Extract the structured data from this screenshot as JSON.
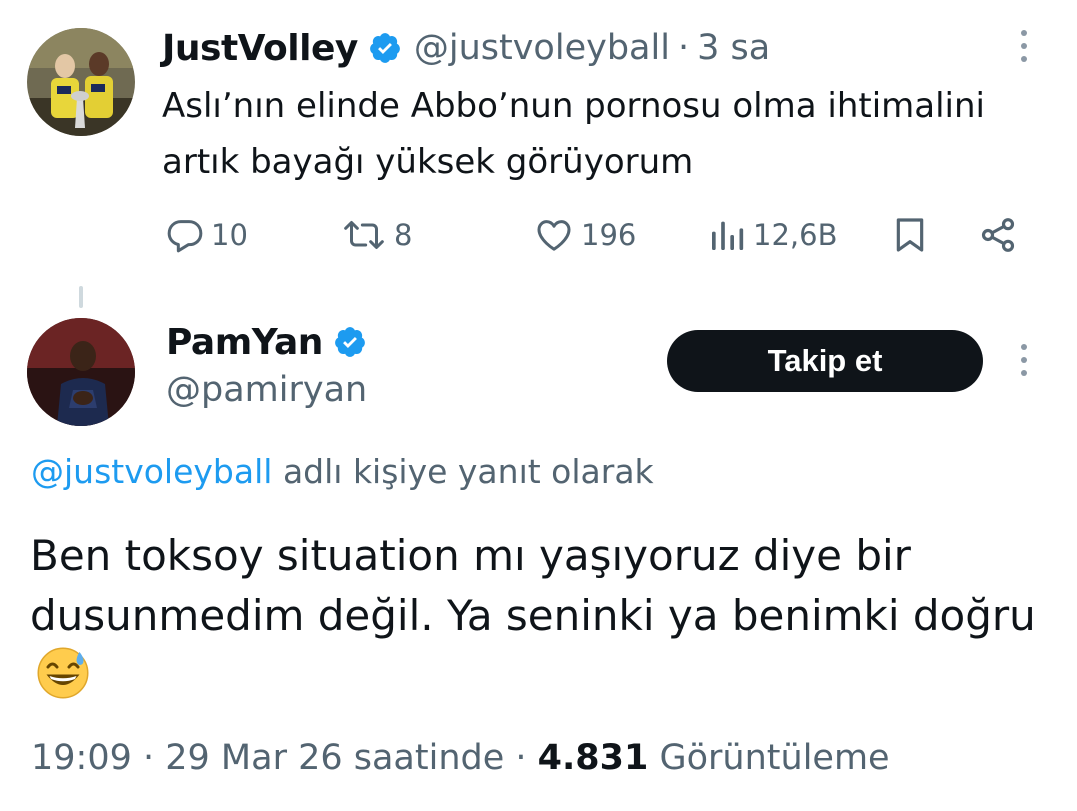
{
  "tweet1": {
    "author_name": "JustVolley",
    "handle": "@justvoleyball",
    "separator": "·",
    "time": "3 sa",
    "text": "Aslı’nın elinde Abbo’nun pornosu olma ihtimalini artık bayağı yüksek görüyorum",
    "actions": {
      "replies": "10",
      "retweets": "8",
      "likes": "196",
      "views": "12,6B"
    }
  },
  "tweet2": {
    "author_name": "PamYan",
    "handle": "@pamiryan",
    "follow_label": "Takip et",
    "reply_mention": "@justvoleyball",
    "reply_suffix": " adlı kişiye yanıt olarak",
    "text": "Ben toksoy situation mı yaşıyoruz diye bir dusunmedim değil. Ya seninki ya benimki doğru",
    "meta": {
      "time": "19:09",
      "sep1": " · ",
      "date": "29 Mar 26 saatinde",
      "sep2": " · ",
      "views_count": "4.831",
      "views_label": " Görüntüleme"
    }
  },
  "icons": {
    "verified": "verified-badge-icon",
    "reply": "reply-icon",
    "retweet": "retweet-icon",
    "like": "heart-icon",
    "views": "views-chart-icon",
    "bookmark": "bookmark-icon",
    "share": "share-icon",
    "more": "more-vertical-icon",
    "emoji": "grinning-face-with-sweat-emoji"
  },
  "colors": {
    "text_primary": "#0f1419",
    "text_secondary": "#536471",
    "link": "#1d9bf0",
    "verified": "#1d9bf0",
    "follow_button_bg": "#0f1419",
    "follow_button_text": "#ffffff"
  }
}
